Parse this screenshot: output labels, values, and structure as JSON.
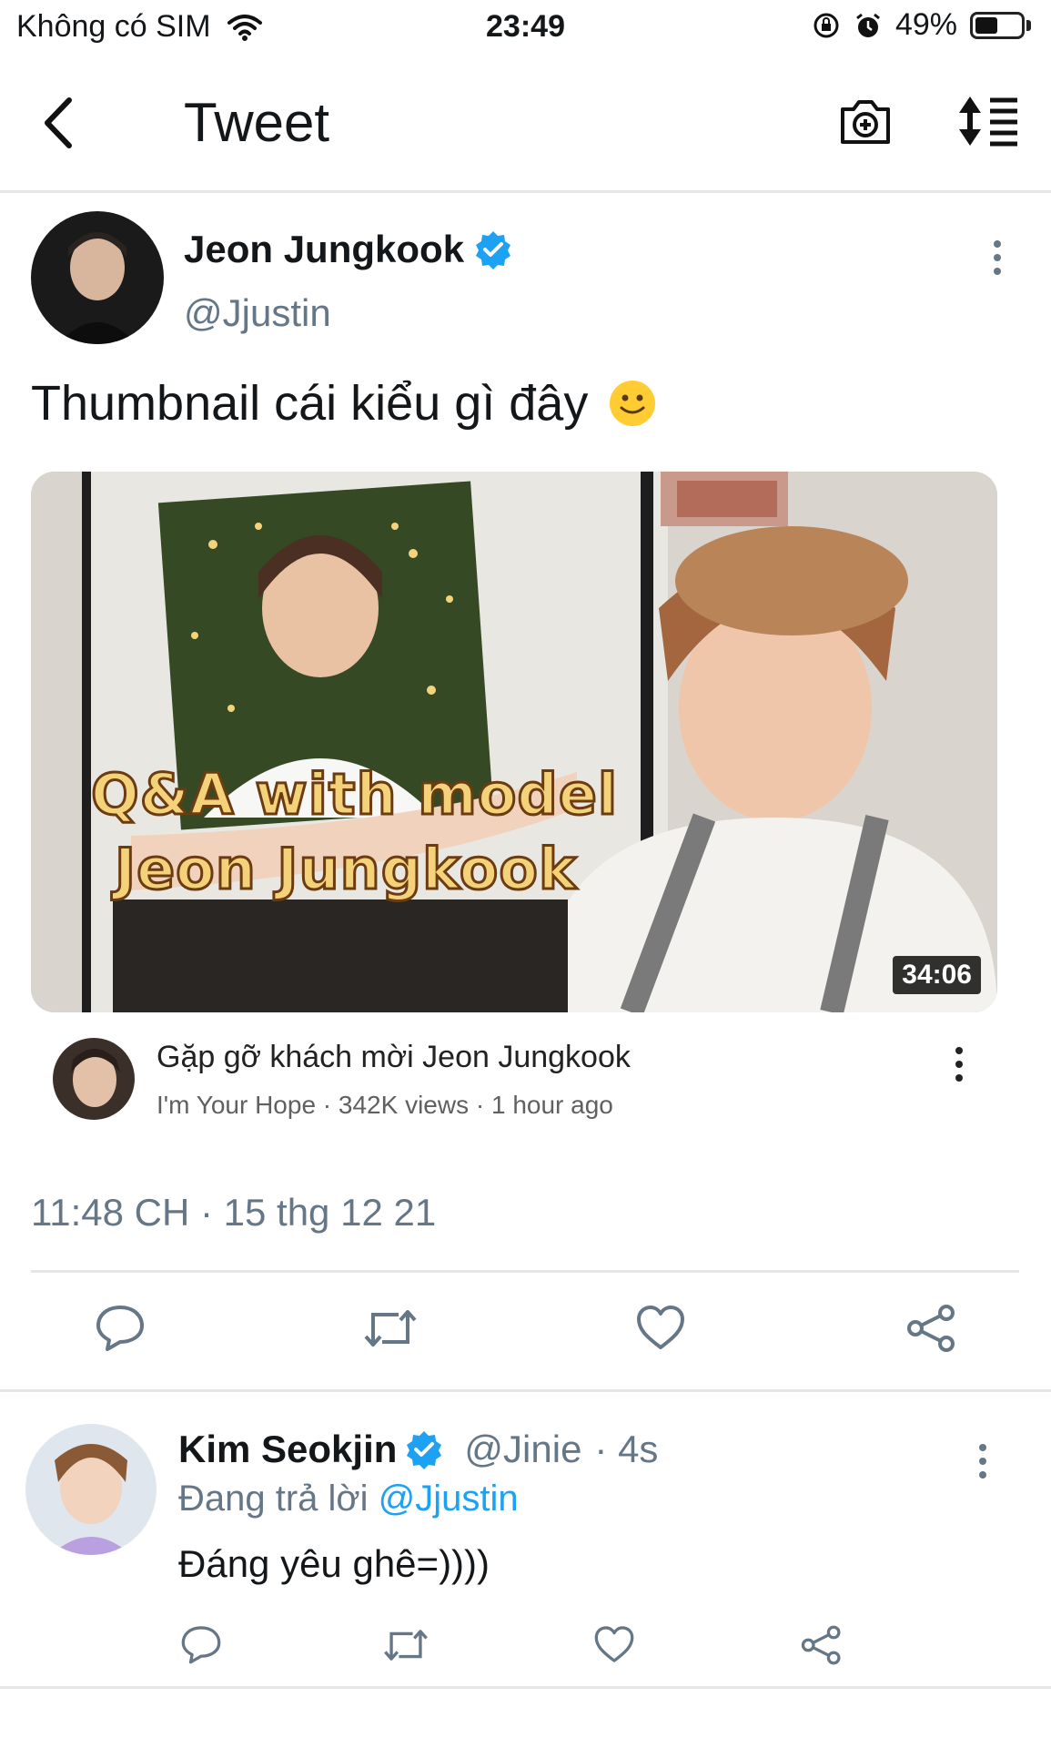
{
  "status_bar": {
    "carrier": "Không có SIM",
    "time": "23:49",
    "battery": "49%",
    "battery_level": 0.49
  },
  "header": {
    "title": "Tweet",
    "icons": [
      "back-chevron-icon",
      "camera-add-icon",
      "sort-timeline-icon"
    ]
  },
  "tweet": {
    "author_name": "Jeon Jungkook",
    "author_handle": "@Jjustin",
    "verified": true,
    "text": "Thumbnail cái kiểu gì đây",
    "emoji": "slightly-smiling-face-icon",
    "video": {
      "overlay_line1": "Q&A with model",
      "overlay_line2": "Jeon Jungkook",
      "duration": "34:06",
      "title": "Gặp gỡ khách mời Jeon Jungkook",
      "meta": "I'm Your Hope · 342K views · 1 hour ago"
    },
    "timestamp": "11:48 CH · 15 thg 12 21",
    "actions": [
      "reply-icon",
      "retweet-icon",
      "like-icon",
      "share-icon"
    ]
  },
  "reply": {
    "author_name": "Kim Seokjin",
    "author_handle": "@Jinie",
    "age": "· 4s",
    "replying_prefix": "Đang trả lời",
    "replying_mention": "@Jjustin",
    "text": "Đáng yêu ghê=))))",
    "actions": [
      "reply-icon",
      "retweet-icon",
      "like-icon",
      "share-icon"
    ]
  },
  "colors": {
    "accent": "#1da1f2",
    "secondary_text": "#657786",
    "divider": "#e6e6e6"
  }
}
